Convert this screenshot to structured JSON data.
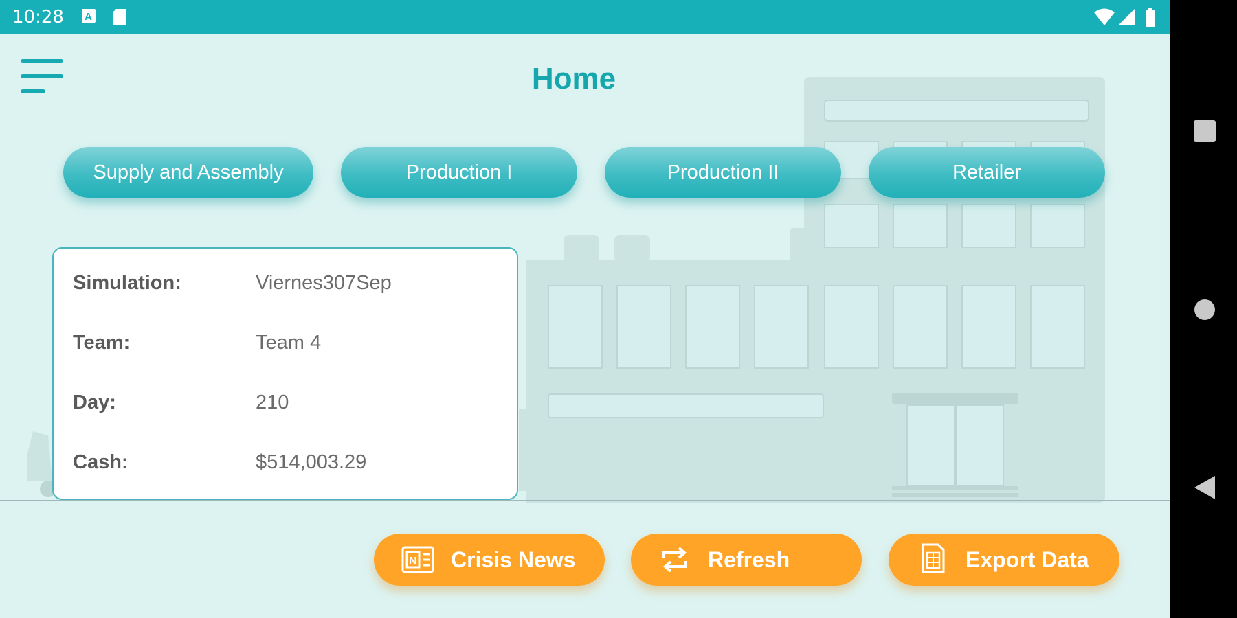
{
  "status_bar": {
    "time": "10:28",
    "left_icons": [
      "a-badge-icon",
      "sd-card-icon"
    ],
    "right_icons": [
      "wifi-icon",
      "signal-icon",
      "battery-icon"
    ]
  },
  "header": {
    "title": "Home",
    "menu_icon": "hamburger-menu-icon"
  },
  "tabs": [
    {
      "label": "Supply and Assembly"
    },
    {
      "label": "Production I"
    },
    {
      "label": "Production II"
    },
    {
      "label": "Retailer"
    }
  ],
  "info": {
    "rows": [
      {
        "label": "Simulation:",
        "value": "Viernes307Sep"
      },
      {
        "label": "Team:",
        "value": "Team 4"
      },
      {
        "label": "Day:",
        "value": "210"
      },
      {
        "label": "Cash:",
        "value": "$514,003.29"
      }
    ]
  },
  "actions": [
    {
      "label": "Crisis News",
      "icon": "news-icon"
    },
    {
      "label": "Refresh",
      "icon": "refresh-icon"
    },
    {
      "label": "Export Data",
      "icon": "document-icon"
    }
  ],
  "nav_bar": {
    "buttons": [
      "recents-square-icon",
      "home-circle-icon",
      "back-triangle-icon"
    ]
  },
  "colors": {
    "primary": "#17b0b8",
    "accent": "#ffa426",
    "background": "#dcf3f1"
  }
}
